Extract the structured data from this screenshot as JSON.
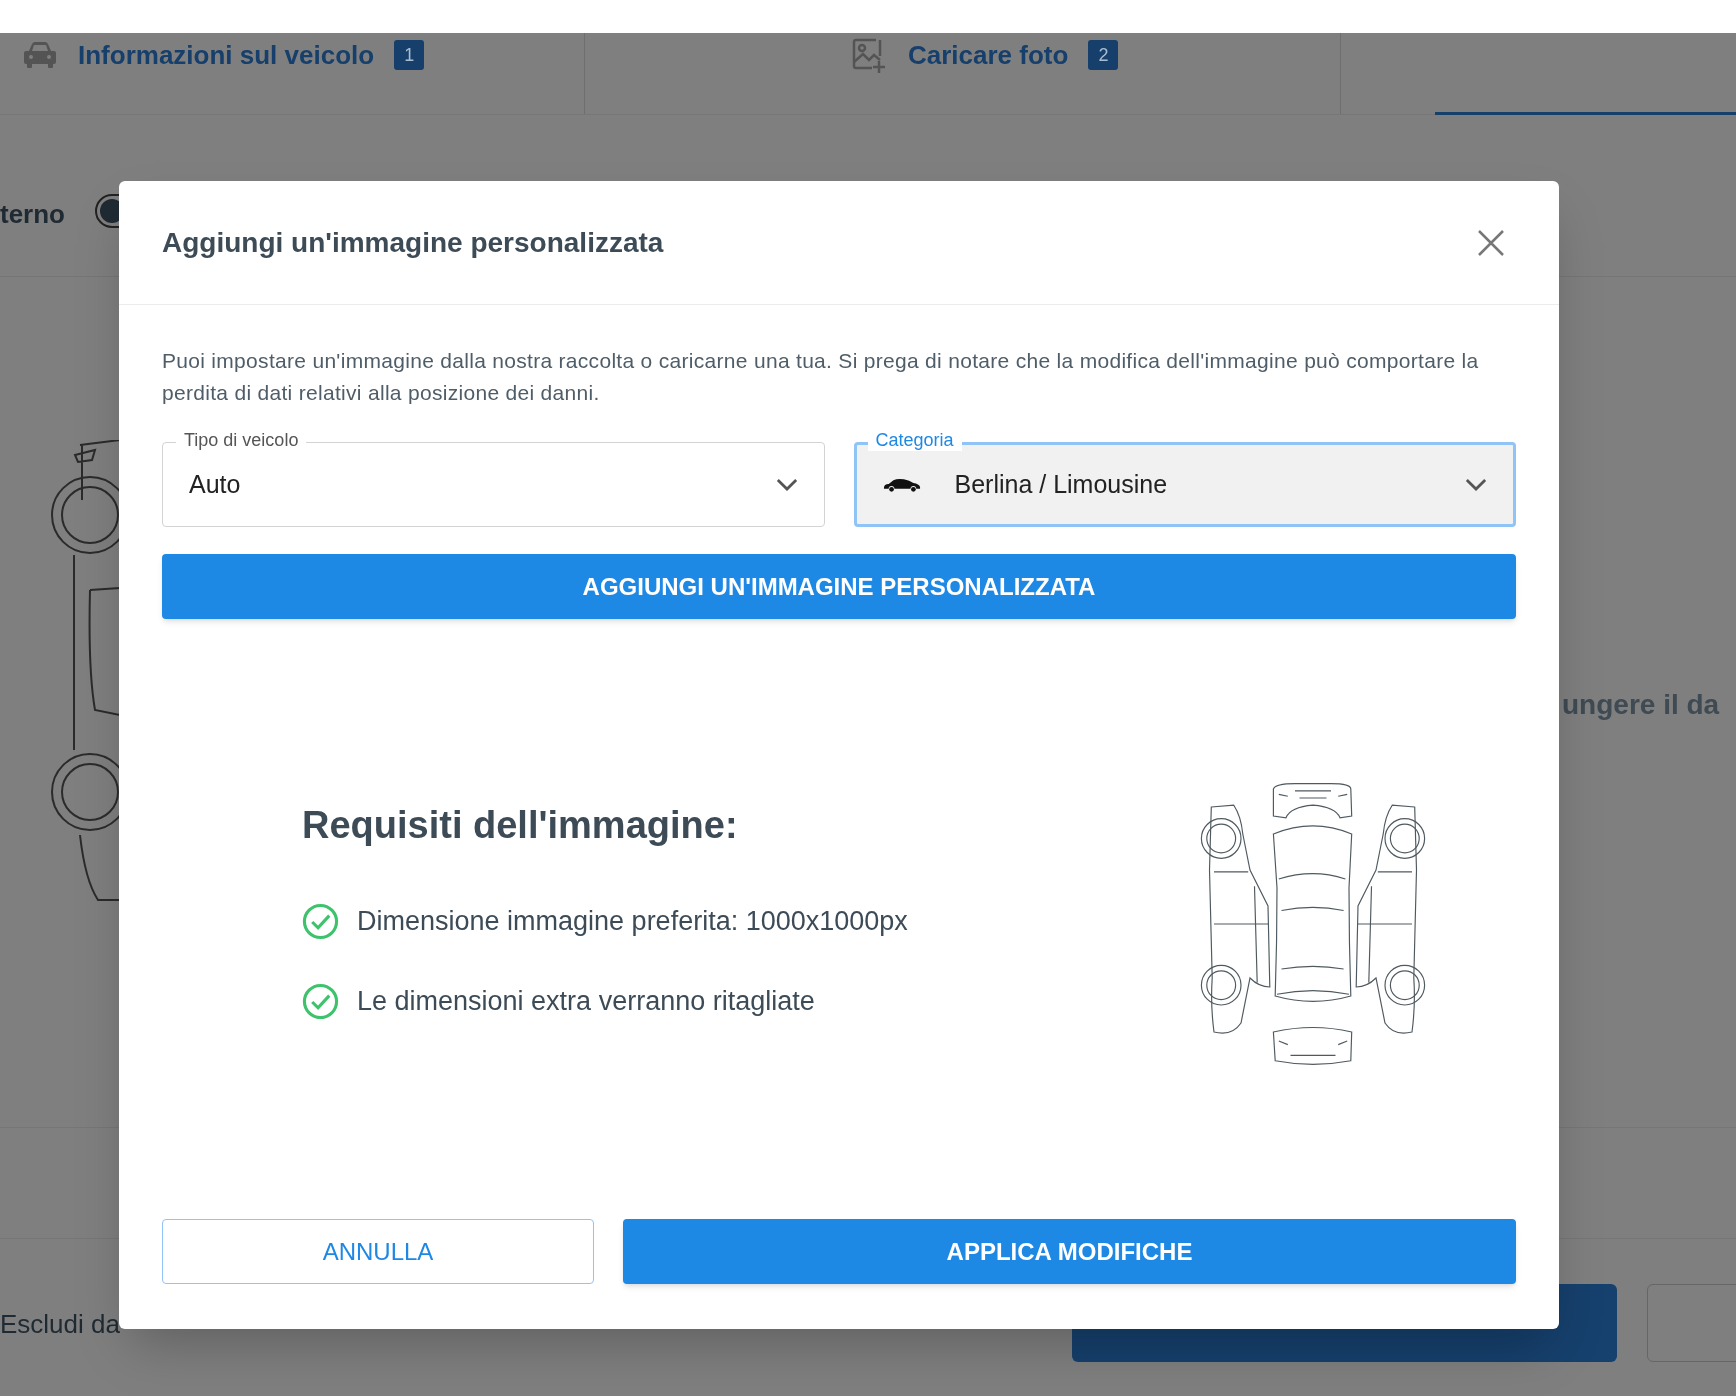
{
  "tabs": [
    {
      "label": "Informazioni sul veicolo",
      "badge": "1",
      "selected": false
    },
    {
      "label": "Caricare foto",
      "badge": "2",
      "selected": false
    },
    {
      "selected": true
    }
  ],
  "background": {
    "toggle_label": "terno",
    "side_text": "ungere il da",
    "toggle_on": false,
    "footer_label": "Escludi da"
  },
  "dialog": {
    "title": "Aggiungi un'immagine personalizzata",
    "description": "Puoi impostare un'immagine dalla nostra raccolta o caricarne una tua. Si prega di notare che la modifica dell'immagine può comportare la perdita di dati relativi alla posizione dei danni.",
    "fields": [
      {
        "kind": "select",
        "label": "Tipo di veicolo",
        "value": "Auto",
        "focused": false
      },
      {
        "kind": "icon-select",
        "label": "Categoria",
        "value": "Berlina / Limousine",
        "focused": true
      }
    ],
    "add_button": "AGGIUNGI UN'IMMAGINE PERSONALIZZATA",
    "requirements": {
      "title": "Requisiti dell'immagine:",
      "items": [
        "Dimensione immagine preferita: 1000x1000px",
        "Le dimensioni extra verranno ritagliate"
      ]
    },
    "buttons": [
      {
        "label": "ANNULLA",
        "kind": "outline"
      },
      {
        "label": "APPLICA MODIFICHE",
        "kind": "primary"
      }
    ]
  }
}
